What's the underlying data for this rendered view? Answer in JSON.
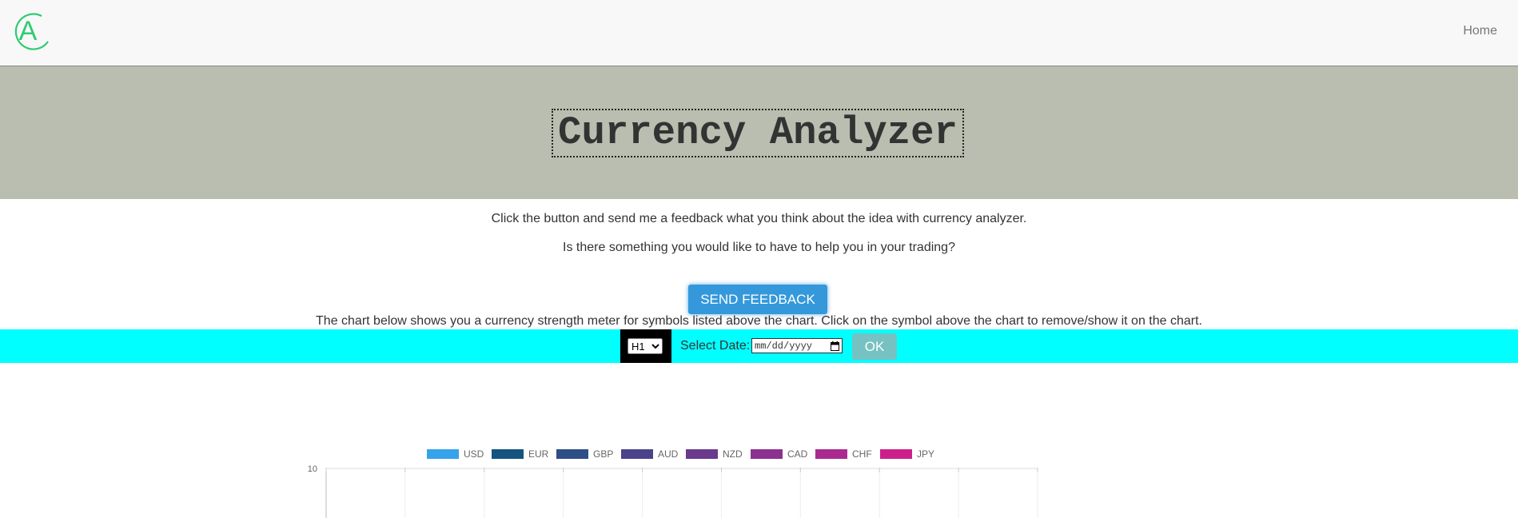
{
  "nav": {
    "home_label": "Home",
    "logo_letter": "A",
    "logo_color": "#2ecc71"
  },
  "hero": {
    "title": "Currency Analyzer",
    "background": "#b9beb0"
  },
  "intro": {
    "line1": "Click the button and send me a feedback what you think about the idea with currency analyzer.",
    "line2": "Is there something you would like to have to help you in your trading?"
  },
  "feedback_button": {
    "label": "SEND FEEDBACK",
    "color": "#3498db"
  },
  "chart_note": "The chart below shows you a currency strength meter for symbols listed above the chart. Click on the symbol above the chart to remove/show it on the chart.",
  "controls": {
    "background": "#00ffff",
    "timeframe_selected": "H1",
    "date_label": "Select Date:",
    "date_placeholder": "mm/dd/yyyy",
    "date_icon": "calendar-icon",
    "ok_label": "OK"
  },
  "chart_data": {
    "type": "line",
    "series": [
      {
        "name": "USD",
        "color": "#36a2eb",
        "values": []
      },
      {
        "name": "EUR",
        "color": "#14547f",
        "values": []
      },
      {
        "name": "GBP",
        "color": "#2e4e86",
        "values": []
      },
      {
        "name": "AUD",
        "color": "#4a4389",
        "values": []
      },
      {
        "name": "NZD",
        "color": "#6a3a8c",
        "values": []
      },
      {
        "name": "CAD",
        "color": "#8b3190",
        "values": []
      },
      {
        "name": "CHF",
        "color": "#aa2a90",
        "values": []
      },
      {
        "name": "JPY",
        "color": "#cc1f8a",
        "values": []
      }
    ],
    "y_top_tick": "10",
    "legend_position": "top-center",
    "grid": true
  }
}
